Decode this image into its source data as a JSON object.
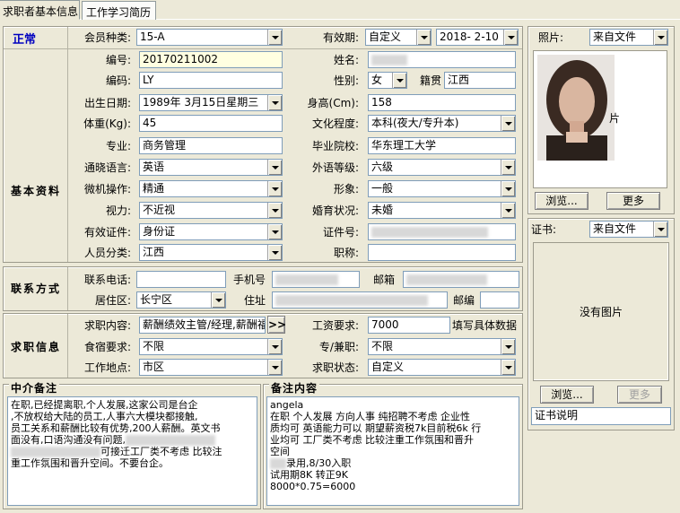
{
  "tabs": [
    "求职者基本信息",
    "工作学习简历"
  ],
  "status": "正常",
  "sections": {
    "basic": "基本资料",
    "contact": "联系方式",
    "job": "求职信息"
  },
  "member_type": {
    "label": "会员种类:",
    "value": "15-A"
  },
  "validity": {
    "label": "有效期:",
    "value": "自定义",
    "date": "2018- 2-10"
  },
  "fields": {
    "number": {
      "label": "编号:",
      "value": "20170211002"
    },
    "name": {
      "label": "姓名:"
    },
    "code": {
      "label": "编码:",
      "value": "LY"
    },
    "gender": {
      "label": "性别:",
      "value": "女"
    },
    "native": {
      "label": "籍贯",
      "value": "江西"
    },
    "birth": {
      "label": "出生日期:",
      "value": "1989年 3月15日星期三"
    },
    "height": {
      "label": "身高(Cm):",
      "value": "158"
    },
    "weight": {
      "label": "体重(Kg):",
      "value": "45"
    },
    "education": {
      "label": "文化程度:",
      "value": "本科(夜大/专升本)"
    },
    "major": {
      "label": "专业:",
      "value": "商务管理"
    },
    "school": {
      "label": "毕业院校:",
      "value": "华东理工大学"
    },
    "language": {
      "label": "通晓语言:",
      "value": "英语"
    },
    "foreign_level": {
      "label": "外语等级:",
      "value": "六级"
    },
    "computer": {
      "label": "微机操作:",
      "value": "精通"
    },
    "appearance": {
      "label": "形象:",
      "value": "一般"
    },
    "vision": {
      "label": "视力:",
      "value": "不近视"
    },
    "marriage": {
      "label": "婚育状况:",
      "value": "未婚"
    },
    "id_type": {
      "label": "有效证件:",
      "value": "身份证"
    },
    "id_no": {
      "label": "证件号:"
    },
    "person_type": {
      "label": "人员分类:",
      "value": "江西"
    },
    "title": {
      "label": "职称:",
      "value": ""
    }
  },
  "contact": {
    "phone_label": "联系电话:",
    "mobile_label": "手机号",
    "email_label": "邮箱",
    "district_label": "居住区:",
    "district_value": "长宁区",
    "address_label": "住址",
    "zip_label": "邮编"
  },
  "job": {
    "content_label": "求职内容:",
    "content_value": "薪酬绩效主管/经理,薪酬福",
    "more_btn": ">>",
    "salary_label": "工资要求:",
    "salary_value": "7000",
    "salary_hint": "填写具体数据",
    "board_label": "食宿要求:",
    "board_value": "不限",
    "parttime_label": "专/兼职:",
    "parttime_value": "不限",
    "location_label": "工作地点:",
    "location_value": "市区",
    "status_label": "求职状态:",
    "status_value": "自定义"
  },
  "photo": {
    "label": "照片:",
    "source": "来自文件",
    "caption": "片",
    "browse": "浏览...",
    "more": "更多"
  },
  "cert": {
    "label": "证书:",
    "source": "来自文件",
    "no_image": "没有图片",
    "browse": "浏览...",
    "more": "更多",
    "desc": "证书说明"
  },
  "agency_notes": {
    "title": "中介备注",
    "lines": [
      "在职,已经提离职,个人发展,这家公司是台企",
      ",不放权给大陆的员工,人事六大模块都接触,",
      "员工关系和薪酬比较有优势,200人薪酬。英文书",
      "面没有,口语沟通没有问题,",
      "可接迁工厂类不考虑 比较注",
      "重工作氛围和晋升空间。不要台企。"
    ]
  },
  "remarks": {
    "title": "备注内容",
    "lines": [
      "angela",
      "在职 个人发展 方向人事 纯招聘不考虑 企业性",
      "质均可 英语能力可以 期望薪资税7k目前税6k 行",
      "业均可 工厂类不考虑 比较注重工作氛围和晋升",
      "空间",
      "录用,8/30入职",
      "试用期8K 转正9K",
      "8000*0.75=6000"
    ]
  }
}
